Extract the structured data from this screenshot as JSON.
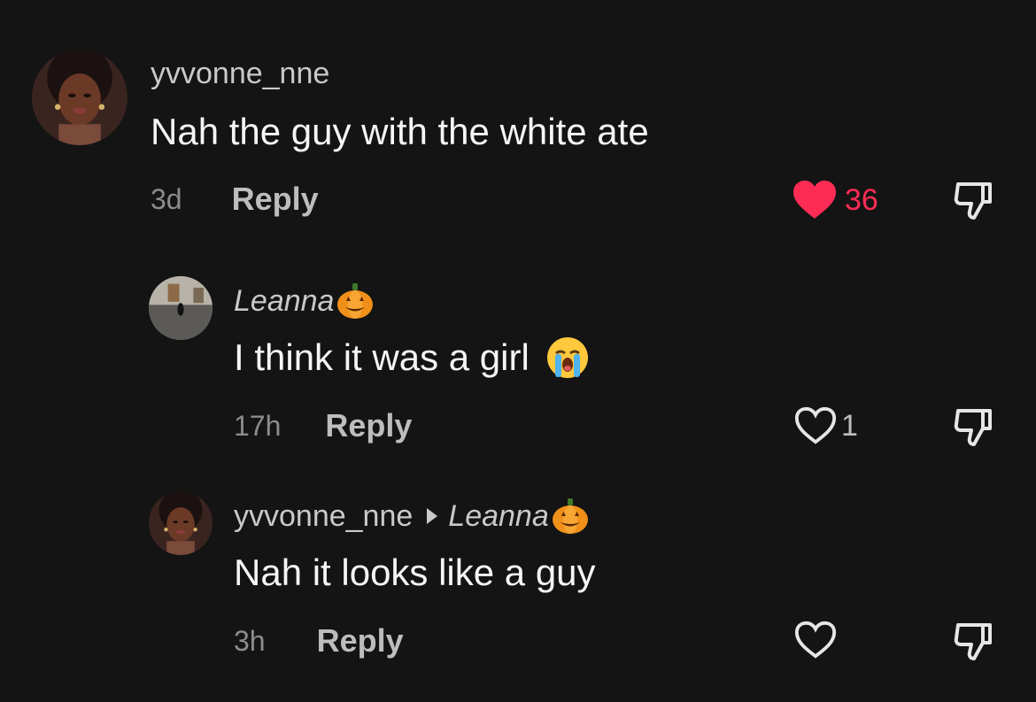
{
  "colors": {
    "background": "#141414",
    "liked_heart": "#fe2c55",
    "muted_text": "#8c8c8c"
  },
  "comments": [
    {
      "username": "yvvonne_nne",
      "text": "Nah the guy with the white ate",
      "time": "3d",
      "reply_label": "Reply",
      "likes": "36",
      "liked": true
    },
    {
      "username": "Leanna",
      "username_suffix_icon": "jack-o-lantern-emoji",
      "text": "I think it was a girl",
      "text_suffix_icon": "loudly-crying-face-emoji",
      "time": "17h",
      "reply_label": "Reply",
      "likes": "1",
      "liked": false
    },
    {
      "username": "yvvonne_nne",
      "reply_to": "Leanna",
      "reply_to_suffix_icon": "jack-o-lantern-emoji",
      "text": "Nah it looks like a guy",
      "time": "3h",
      "reply_label": "Reply",
      "likes": "",
      "liked": false
    }
  ]
}
